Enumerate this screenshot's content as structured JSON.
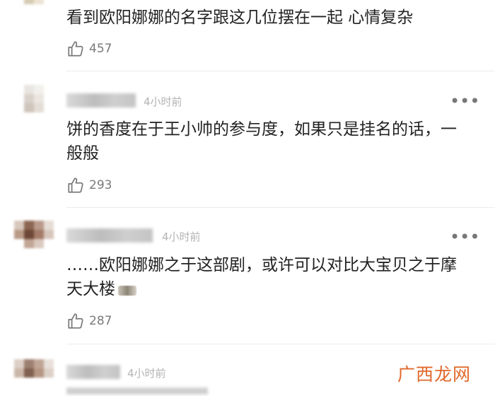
{
  "comments": [
    {
      "text": "看到欧阳娜娜的名字跟这几位摆在一起 心情复杂",
      "likes": "457"
    },
    {
      "time": "4小时前",
      "text": "饼的香度在于王小帅的参与度，如果只是挂名的话，一般般",
      "likes": "293"
    },
    {
      "time": "4小时前",
      "text": "……欧阳娜娜之于这部剧，或许可以对比大宝贝之于摩天大楼",
      "likes": "287"
    },
    {
      "time": "4小时前"
    }
  ],
  "more_label": "•••",
  "watermark": "广西龙网",
  "colors": {
    "like_icon": "#7a7a7a",
    "watermark": "#e1682b"
  }
}
